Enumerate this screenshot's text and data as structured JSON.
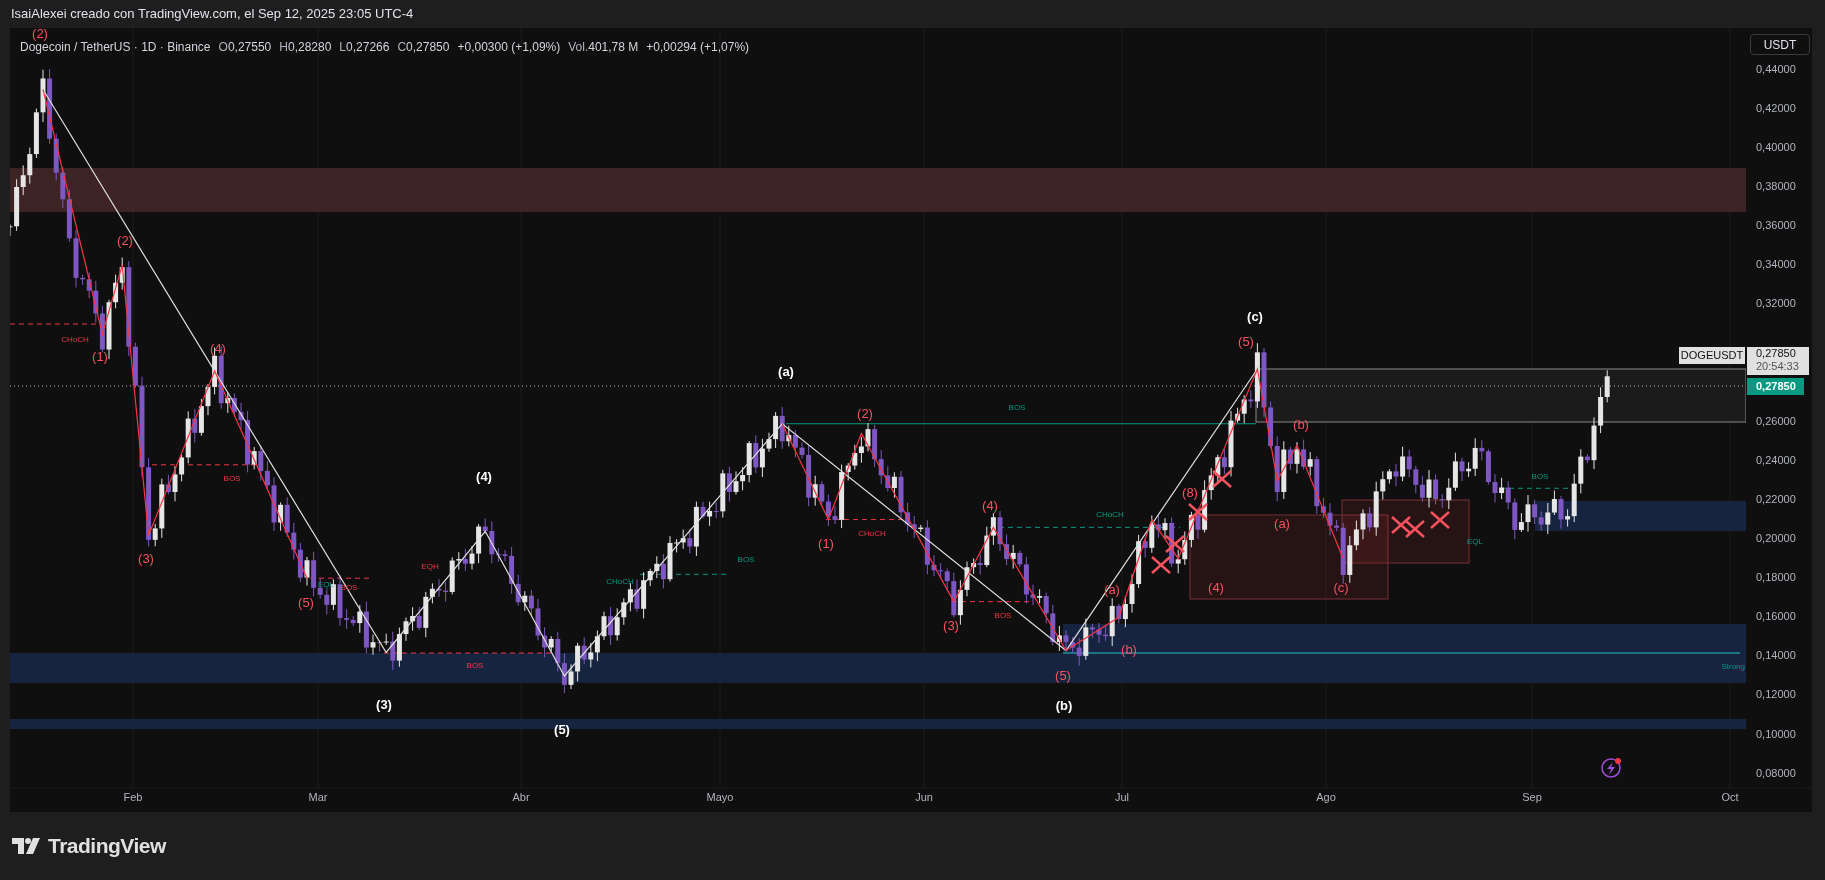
{
  "header": {
    "title": "IsaiAlexei creado con TradingView.com, el Sep 12, 2025 23:05 UTC-4"
  },
  "legend": {
    "symbol": "Dogecoin / TetherUS · 1D · Binance",
    "values": [
      {
        "label": "O",
        "value": "0,27550"
      },
      {
        "label": "H",
        "value": "0,28280"
      },
      {
        "label": "L",
        "value": "0,27266"
      },
      {
        "label": "C",
        "value": "0,27850"
      }
    ],
    "change": "+0,00300 (+1,09%)",
    "volume_label": "Vol.",
    "volume": "401,78 M",
    "volume_change": "+0,00294 (+1,07%)"
  },
  "currency_button": "USDT",
  "price_axis": [
    "0,44000",
    "0,42000",
    "0,40000",
    "0,38000",
    "0,36000",
    "0,34000",
    "0,32000",
    "0,26000",
    "0,24000",
    "0,22000",
    "0,20000",
    "0,18000",
    "0,16000",
    "0,14000",
    "0,12000",
    "0,10000",
    "0,08000"
  ],
  "time_axis": [
    "Feb",
    "Mar",
    "Abr",
    "Mayo",
    "Jun",
    "Jul",
    "Ago",
    "Sep",
    "Oct"
  ],
  "price_tag": {
    "symbol": "DOGEUSDT",
    "price": "0,27850",
    "countdown": "20:54:33",
    "last_price": "0,27850"
  },
  "annotations": [
    {
      "text": "(2)",
      "kind": "minor-wave"
    },
    {
      "text": "(2)",
      "kind": "minor-wave"
    },
    {
      "text": "CHoCH",
      "kind": "bearish-tag"
    },
    {
      "text": "(1)",
      "kind": "minor-wave"
    },
    {
      "text": "(4)",
      "kind": "minor-wave"
    },
    {
      "text": "BOS",
      "kind": "bearish-tag"
    },
    {
      "text": "(3)",
      "kind": "minor-wave"
    },
    {
      "text": "EQH",
      "kind": "bearish-tag"
    },
    {
      "text": "(5)",
      "kind": "minor-wave"
    },
    {
      "text": "EQL",
      "kind": "bullish-tag"
    },
    {
      "text": "BOS",
      "kind": "bearish-tag"
    },
    {
      "text": "(4)",
      "kind": "major-wave"
    },
    {
      "text": "BOS",
      "kind": "bearish-tag"
    },
    {
      "text": "(3)",
      "kind": "major-wave"
    },
    {
      "text": "(5)",
      "kind": "major-wave"
    },
    {
      "text": "(a)",
      "kind": "major-wave"
    },
    {
      "text": "CHoCH",
      "kind": "bullish-tag"
    },
    {
      "text": "BOS",
      "kind": "bullish-tag"
    },
    {
      "text": "(2)",
      "kind": "minor-wave"
    },
    {
      "text": "BOS",
      "kind": "bullish-tag"
    },
    {
      "text": "(1)",
      "kind": "minor-wave"
    },
    {
      "text": "CHoCH",
      "kind": "bearish-tag"
    },
    {
      "text": "(4)",
      "kind": "minor-wave"
    },
    {
      "text": "(3)",
      "kind": "minor-wave"
    },
    {
      "text": "BOS",
      "kind": "bearish-tag"
    },
    {
      "text": "(5)",
      "kind": "minor-wave"
    },
    {
      "text": "(b)",
      "kind": "major-wave"
    },
    {
      "text": "CHoCH",
      "kind": "bullish-tag"
    },
    {
      "text": "(a)",
      "kind": "minor-wave"
    },
    {
      "text": "(b)",
      "kind": "minor-wave"
    },
    {
      "text": "(8)",
      "kind": "minor-wave"
    },
    {
      "text": "(c)",
      "kind": "major-wave"
    },
    {
      "text": "(5)",
      "kind": "minor-wave"
    },
    {
      "text": "(b)",
      "kind": "minor-wave"
    },
    {
      "text": "(a)",
      "kind": "minor-wave"
    },
    {
      "text": "(4)",
      "kind": "minor-wave"
    },
    {
      "text": "(c)",
      "kind": "minor-wave"
    },
    {
      "text": "EQL",
      "kind": "bullish-tag"
    },
    {
      "text": "BOS",
      "kind": "bullish-tag"
    },
    {
      "text": "Strong",
      "kind": "bullish-tag"
    }
  ],
  "footer": {
    "logo_text": "TradingView"
  }
}
